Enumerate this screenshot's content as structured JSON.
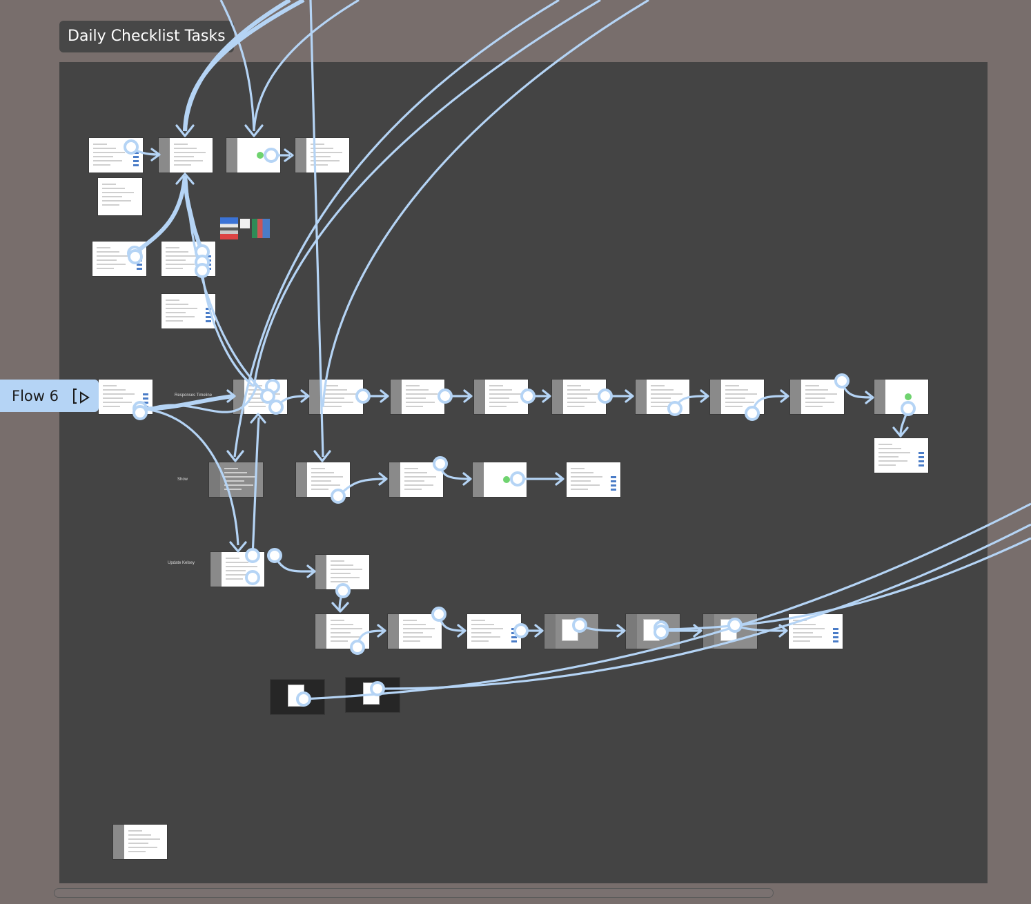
{
  "section": {
    "title": "Daily Checklist Tasks"
  },
  "flow": {
    "label": "Flow 6"
  },
  "labels": {
    "responses_timeline": "Responses Timeline",
    "show": "Show",
    "update_kelsey": "Update Kelsey"
  },
  "colors": {
    "canvas_background": "#786e6c",
    "section_background": "#444444",
    "connector": "#b5d4f5",
    "flow_tag": "#b5d4f5"
  },
  "icons": {
    "flow_play": "play-flow-icon"
  }
}
